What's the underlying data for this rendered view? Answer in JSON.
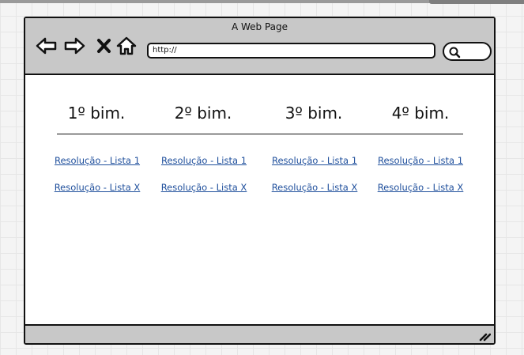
{
  "browser": {
    "title": "A Web Page",
    "address": "http://",
    "icons": [
      "back-arrow-icon",
      "forward-arrow-icon",
      "stop-x-icon",
      "home-icon",
      "search-icon",
      "resize-grip-icon"
    ]
  },
  "columns": [
    {
      "heading": "1º bim.",
      "links": [
        "Resolução - Lista 1",
        "Resolução - Lista X"
      ]
    },
    {
      "heading": "2º bim.",
      "links": [
        "Resolução - Lista 1",
        "Resolução - Lista X"
      ]
    },
    {
      "heading": "3º bim.",
      "links": [
        "Resolução - Lista 1",
        "Resolução - Lista X"
      ]
    },
    {
      "heading": "4º bim.",
      "links": [
        "Resolução - Lista 1",
        "Resolução - Lista X"
      ]
    }
  ],
  "colors": {
    "link": "#1f4f9c",
    "chrome": "#c8c8c8",
    "outline": "#111111"
  }
}
